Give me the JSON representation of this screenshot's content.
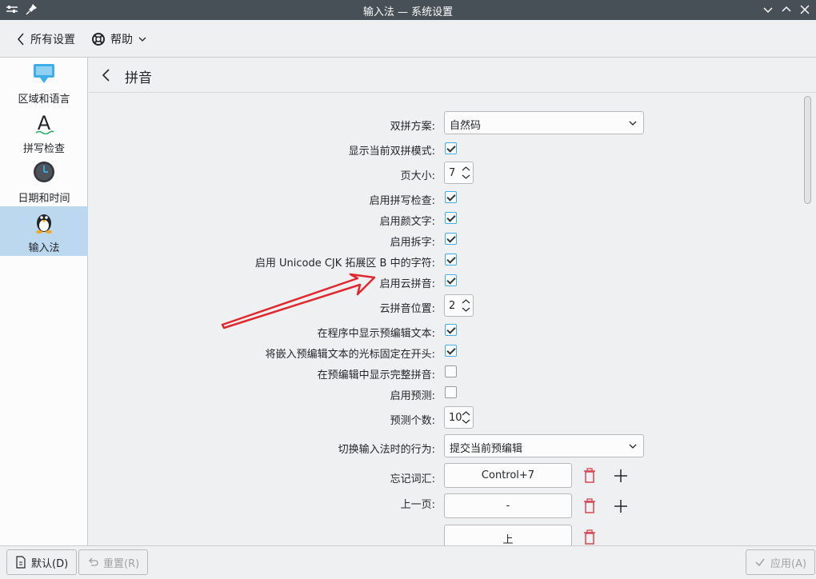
{
  "window": {
    "title": "输入法 — 系统设置"
  },
  "toolbar": {
    "all_settings": "所有设置",
    "help": "帮助"
  },
  "sidebar": {
    "items": [
      {
        "label": "区域和语言",
        "icon": "chat-bubble-icon"
      },
      {
        "label": "拼写检查",
        "icon": "letter-a-icon"
      },
      {
        "label": "日期和时间",
        "icon": "clock-icon"
      },
      {
        "label": "输入法",
        "icon": "penguin-icon",
        "active": true
      }
    ]
  },
  "content": {
    "title": "拼音"
  },
  "form": {
    "shuangpin_scheme": {
      "label": "双拼方案:",
      "value": "自然码"
    },
    "show_shuangpin_mode": {
      "label": "显示当前双拼模式:",
      "checked": true
    },
    "page_size": {
      "label": "页大小:",
      "value": "7"
    },
    "spell_check": {
      "label": "启用拼写检查:",
      "checked": true
    },
    "emoticons": {
      "label": "启用颜文字:",
      "checked": true
    },
    "chaizi": {
      "label": "启用拆字:",
      "checked": true
    },
    "cjk_ext_b": {
      "label": "启用 Unicode CJK 拓展区 B 中的字符:",
      "checked": true
    },
    "cloud_pinyin": {
      "label": "启用云拼音:",
      "checked": true
    },
    "cloud_position": {
      "label": "云拼音位置:",
      "value": "2"
    },
    "show_preedit_in_app": {
      "label": "在程序中显示预编辑文本:",
      "checked": true
    },
    "cursor_at_start": {
      "label": "将嵌入预编辑文本的光标固定在开头:",
      "checked": true
    },
    "show_full_pinyin": {
      "label": "在预编辑中显示完整拼音:",
      "checked": false
    },
    "prediction": {
      "label": "启用预测:",
      "checked": false
    },
    "prediction_count": {
      "label": "预测个数:",
      "value": "10"
    },
    "switch_behavior": {
      "label": "切换输入法时的行为:",
      "value": "提交当前预编辑"
    },
    "forget_word": {
      "label": "忘记词汇:",
      "key": "Control+7"
    },
    "prev_page": {
      "label": "上一页:",
      "keys": [
        "-",
        "上"
      ]
    }
  },
  "bottom": {
    "defaults": "默认(D)",
    "reset": "重置(R)",
    "apply": "应用(A)"
  },
  "colors": {
    "titlebar": "#475057",
    "active_sidebar": "#bcd8ee",
    "accent": "#3daee9",
    "delete": "#da4453",
    "annotation_arrow": "#e0282e"
  }
}
